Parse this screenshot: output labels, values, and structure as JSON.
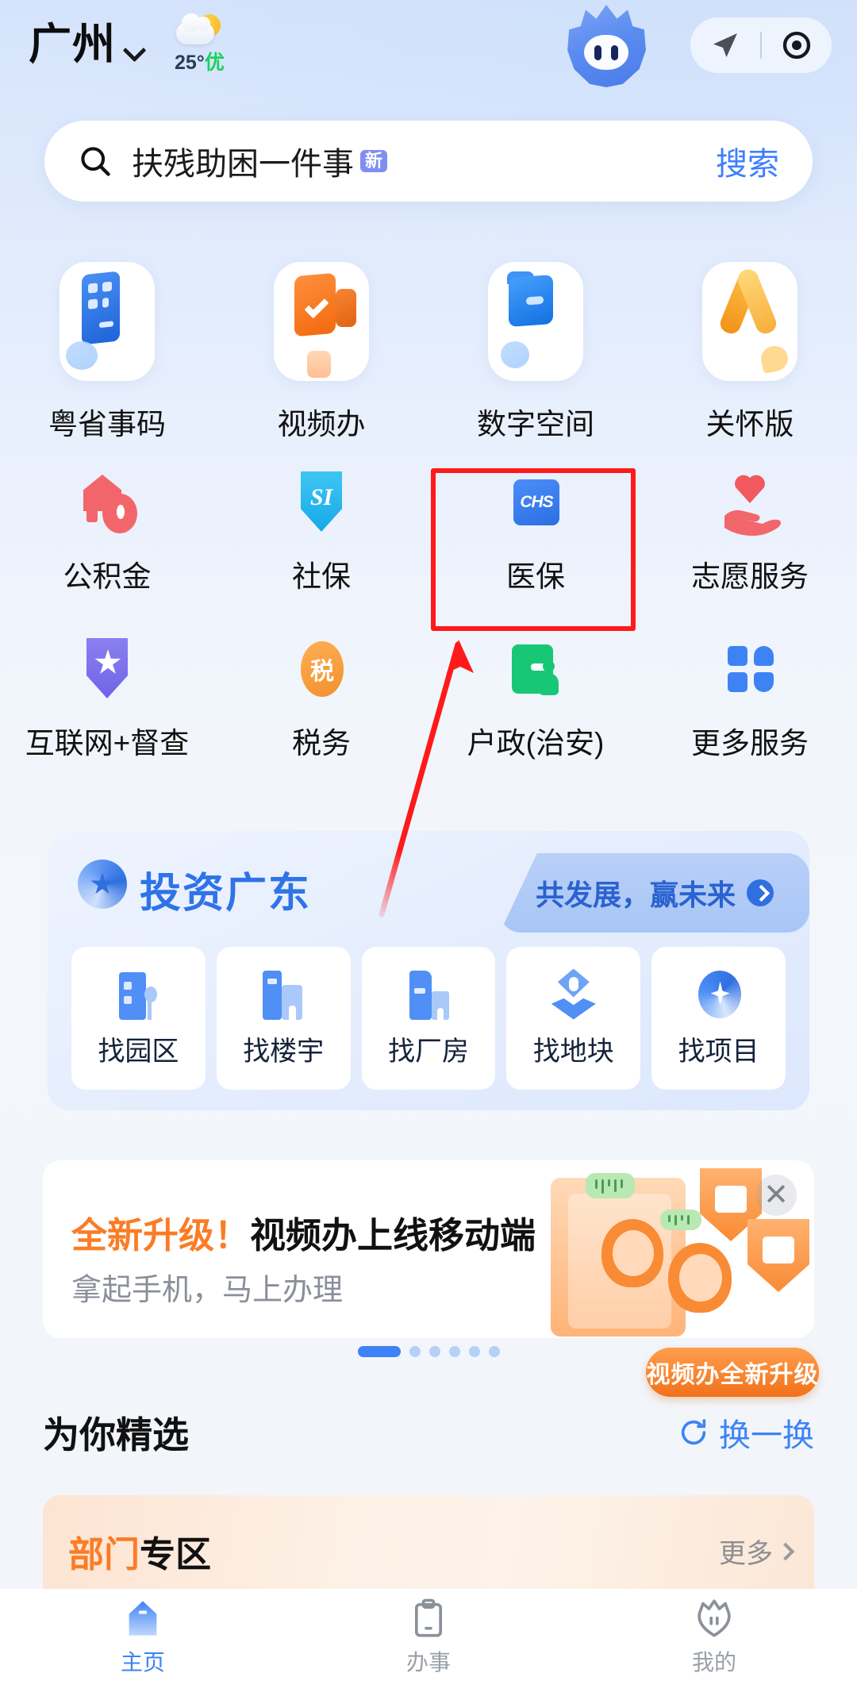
{
  "header": {
    "city": "广州",
    "chevron_icon": "chevron-down-icon",
    "weather": {
      "icon": "sun-behind-cloud-icon",
      "temp": "25°",
      "aqi": "优"
    },
    "mascot_icon": "mascot-avatar-icon",
    "location_pill": {
      "navigate_icon": "navigation-arrow-icon",
      "locate_icon": "target-circle-icon"
    }
  },
  "search": {
    "icon": "search-icon",
    "keyword": "扶残助困一件事",
    "badge": "新",
    "button": "搜索"
  },
  "grid": {
    "rows": [
      [
        {
          "label": "粤省事码",
          "icon": "id-code-card-icon"
        },
        {
          "label": "视频办",
          "icon": "video-handle-icon"
        },
        {
          "label": "数字空间",
          "icon": "digital-space-folder-icon"
        },
        {
          "label": "关怀版",
          "icon": "care-ribbon-icon"
        }
      ],
      [
        {
          "label": "公积金",
          "icon": "housing-fund-icon"
        },
        {
          "label": "社保",
          "icon": "social-insurance-shield-icon"
        },
        {
          "label": "医保",
          "icon": "chs-medical-insurance-icon"
        },
        {
          "label": "志愿服务",
          "icon": "volunteer-heart-hand-icon"
        }
      ],
      [
        {
          "label": "互联网+督查",
          "icon": "supervision-shield-star-icon"
        },
        {
          "label": "税务",
          "icon": "tax-icon"
        },
        {
          "label": "户政(治安)",
          "icon": "household-police-card-icon"
        },
        {
          "label": "更多服务",
          "icon": "more-services-grid-icon"
        }
      ]
    ]
  },
  "invest": {
    "logo_icon": "invest-guangdong-logo-icon",
    "title": "投资广东",
    "pill_text": "共发展，赢未来",
    "pill_chevron_icon": "chevron-right-circle-icon",
    "items": [
      {
        "label": "找园区",
        "icon": "industrial-park-icon"
      },
      {
        "label": "找楼宇",
        "icon": "office-building-icon"
      },
      {
        "label": "找厂房",
        "icon": "factory-icon"
      },
      {
        "label": "找地块",
        "icon": "land-parcel-pin-icon"
      },
      {
        "label": "找项目",
        "icon": "project-star-icon"
      }
    ]
  },
  "promo": {
    "title_highlight": "全新升级！",
    "title_rest": "视频办上线移动端",
    "subtitle": "拿起手机，马上办理",
    "close_icon": "close-icon",
    "badge": "视频办全新升级",
    "dots_total": 6,
    "dots_active_index": 0
  },
  "section": {
    "title": "为你精选",
    "action": "换一换",
    "action_icon": "refresh-icon"
  },
  "dept": {
    "title_highlight": "部门",
    "title_rest": "专区",
    "more": "更多",
    "more_icon": "chevron-right-icon"
  },
  "tabbar": {
    "items": [
      {
        "label": "主页",
        "icon": "home-icon",
        "active": true
      },
      {
        "label": "办事",
        "icon": "clipboard-icon",
        "active": false
      },
      {
        "label": "我的",
        "icon": "profile-icon",
        "active": false
      }
    ]
  },
  "annotation": {
    "highlight_target": "医保",
    "box_color": "#ff1a1a",
    "arrow_color": "#ff1a1a"
  }
}
